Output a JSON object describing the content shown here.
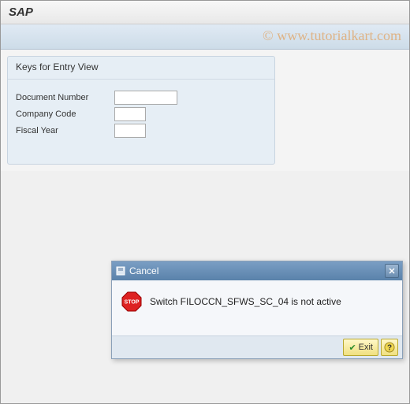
{
  "header": {
    "title": "SAP"
  },
  "watermark": "© www.tutorialkart.com",
  "group": {
    "title": "Keys for Entry View",
    "fields": {
      "doc_num": {
        "label": "Document Number",
        "value": ""
      },
      "company": {
        "label": "Company Code",
        "value": ""
      },
      "fiscal": {
        "label": "Fiscal Year",
        "value": ""
      }
    }
  },
  "dialog": {
    "title": "Cancel",
    "message": "Switch FILOCCN_SFWS_SC_04 is not active",
    "buttons": {
      "exit": "Exit",
      "help": "?"
    }
  }
}
